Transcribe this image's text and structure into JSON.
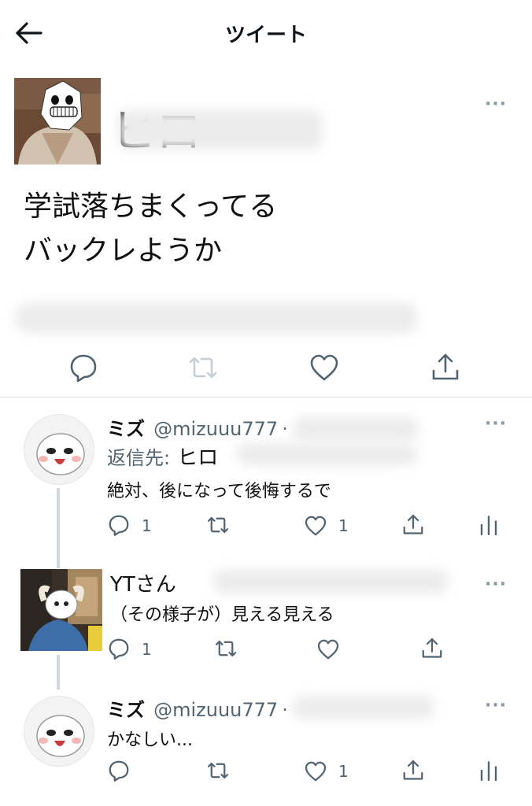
{
  "header": {
    "title": "ツイート"
  },
  "main_tweet": {
    "author_name": "ヒロ",
    "text_lines": [
      "学試落ちまくってる",
      "バックレようか"
    ]
  },
  "replies": [
    {
      "name": "ミズ",
      "handle": "@mizuuu777",
      "separator": "·",
      "reply_to_label": "返信先:",
      "reply_to_name": "ヒロ",
      "text": "絶対、後になって後悔するで",
      "reply_count": "1",
      "like_count": "1"
    },
    {
      "name": "YTさん",
      "text": "（その様子が）見える見える",
      "reply_count": "1"
    },
    {
      "name": "ミズ",
      "handle": "@mizuuu777",
      "separator": "·",
      "text": "かなしい...",
      "like_count": "1"
    }
  ],
  "more_label": "···"
}
